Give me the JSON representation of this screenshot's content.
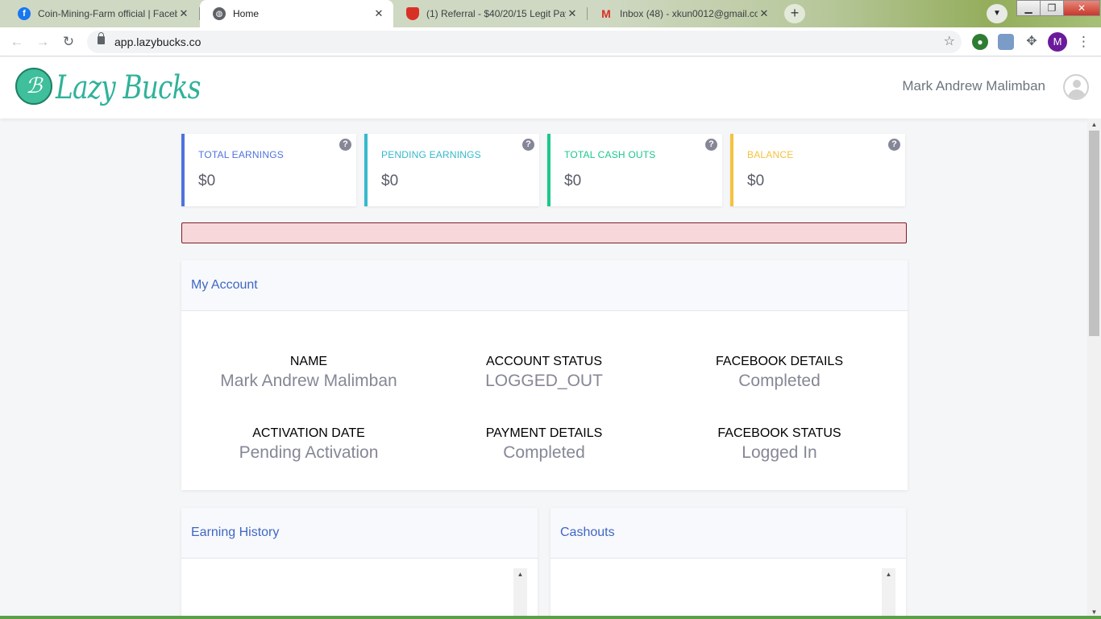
{
  "browser": {
    "tabs": [
      {
        "title": "Coin-Mining-Farm official | Faceb",
        "icon": "facebook-icon"
      },
      {
        "title": "Home",
        "icon": "globe-icon"
      },
      {
        "title": "(1) Referral - $40/20/15 Legit Pay",
        "icon": "shield-icon"
      },
      {
        "title": "Inbox (48) - xkun0012@gmail.co",
        "icon": "gmail-icon"
      }
    ],
    "active_tab_index": 1,
    "url": "app.lazybucks.co",
    "profile_initial": "M"
  },
  "header": {
    "logo_text": "Lazy Bucks",
    "logo_glyph": "ℬ",
    "username": "Mark Andrew Malimban"
  },
  "stats": [
    {
      "label": "TOTAL EARNINGS",
      "value": "$0",
      "color": "#4e73df",
      "help": "?"
    },
    {
      "label": "PENDING EARNINGS",
      "value": "$0",
      "color": "#36b9cc",
      "help": "?"
    },
    {
      "label": "TOTAL CASH OUTS",
      "value": "$0",
      "color": "#1cc88a",
      "help": "?"
    },
    {
      "label": "BALANCE",
      "value": "$0",
      "color": "#f6c23e",
      "help": "?"
    }
  ],
  "account": {
    "title": "My Account",
    "fields": [
      {
        "key": "NAME",
        "value": "Mark Andrew Malimban"
      },
      {
        "key": "ACCOUNT STATUS",
        "value": "LOGGED_OUT"
      },
      {
        "key": "FACEBOOK DETAILS",
        "value": "Completed"
      },
      {
        "key": "ACTIVATION DATE",
        "value": "Pending Activation"
      },
      {
        "key": "PAYMENT DETAILS",
        "value": "Completed"
      },
      {
        "key": "FACEBOOK STATUS",
        "value": "Logged In"
      }
    ]
  },
  "earning_history": {
    "title": "Earning History"
  },
  "cashouts": {
    "title": "Cashouts"
  }
}
